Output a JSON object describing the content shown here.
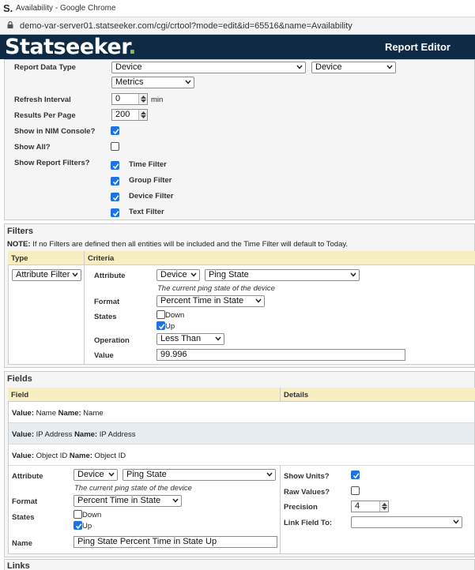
{
  "window": {
    "title": "Availability - Google Chrome",
    "favicon": "S."
  },
  "url": "demo-var-server01.statseeker.com/cgi/crtool?mode=edit&id=65516&name=Availability",
  "header": {
    "logo_text": "Statseeker",
    "logo_dot": ".",
    "title": "Report Editor"
  },
  "report": {
    "data_type_label": "Report Data Type",
    "data_type_1": "Device",
    "data_type_2": "Device",
    "data_type_3": "Metrics",
    "refresh_label": "Refresh Interval",
    "refresh_value": "0",
    "refresh_unit": "min",
    "results_label": "Results Per Page",
    "results_value": "200",
    "nim_label": "Show in NIM Console?",
    "nim_checked": true,
    "showall_label": "Show All?",
    "showall_checked": false,
    "filters_label": "Show Report Filters?",
    "filter_options": [
      {
        "label": "Time Filter",
        "checked": true
      },
      {
        "label": "Group Filter",
        "checked": true
      },
      {
        "label": "Device Filter",
        "checked": true
      },
      {
        "label": "Text Filter",
        "checked": true
      }
    ]
  },
  "filters": {
    "title": "Filters",
    "note_bold": "NOTE:",
    "note_text": " If no Filters are defined then all entities will be included and the Time Filter will default to Today.",
    "col_type": "Type",
    "col_criteria": "Criteria",
    "type_value": "Attribute Filter",
    "attribute_label": "Attribute",
    "attribute_entity": "Device",
    "attribute_value": "Ping State",
    "attribute_desc": "The current ping state of the device",
    "format_label": "Format",
    "format_value": "Percent Time in State",
    "states_label": "States",
    "states": [
      {
        "label": "Down",
        "checked": false
      },
      {
        "label": "Up",
        "checked": true
      }
    ],
    "operation_label": "Operation",
    "operation_value": "Less Than",
    "value_label": "Value",
    "value_value": "99.996"
  },
  "fields": {
    "title": "Fields",
    "col_field": "Field",
    "col_details": "Details",
    "value_word": "Value:",
    "name_word": "Name:",
    "rows": [
      {
        "value": " Name ",
        "name": " Name"
      },
      {
        "value": " IP Address ",
        "name": " IP Address"
      },
      {
        "value": " Object ID ",
        "name": " Object ID"
      }
    ],
    "attribute_label": "Attribute",
    "attribute_entity": "Device",
    "attribute_value": "Ping State",
    "attribute_desc": "The current ping state of the device",
    "format_label": "Format",
    "format_value": "Percent Time in State",
    "states_label": "States",
    "states": [
      {
        "label": "Down",
        "checked": false
      },
      {
        "label": "Up",
        "checked": true
      }
    ],
    "name_label": "Name",
    "name_value": "Ping State Percent Time in State Up",
    "show_units_label": "Show Units?",
    "show_units_checked": true,
    "raw_values_label": "Raw Values?",
    "raw_values_checked": false,
    "precision_label": "Precision",
    "precision_value": "4",
    "link_label": "Link Field To:",
    "link_value": ""
  },
  "links": {
    "title": "Links"
  },
  "colors": {
    "header_bg": "#0f2a44",
    "logo_dot": "#7ec247",
    "checkbox": "#1a73e8",
    "table_header": "#f7efc2"
  }
}
